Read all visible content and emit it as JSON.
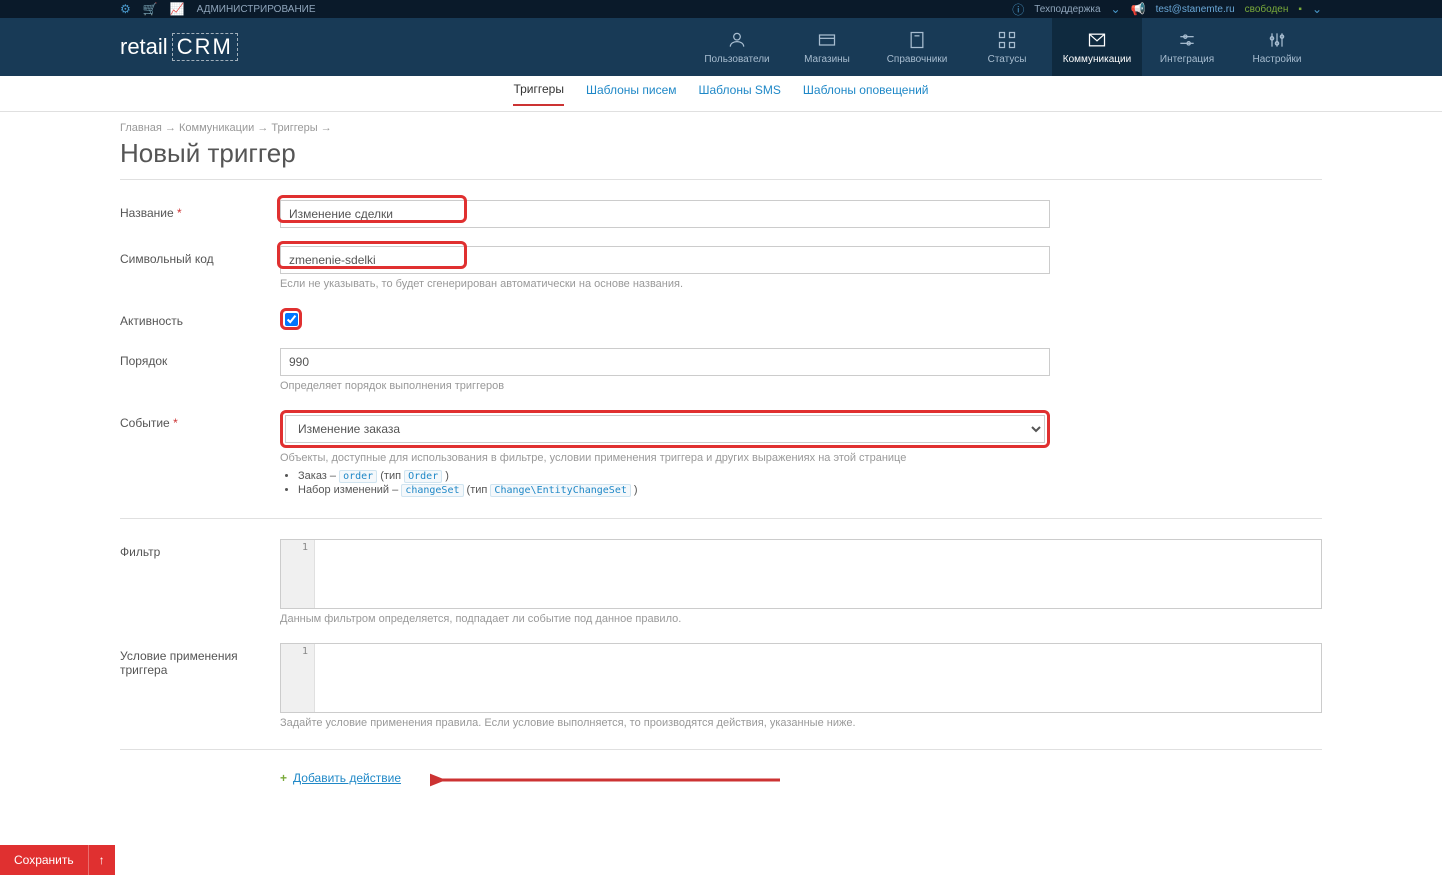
{
  "topbar": {
    "admin": "АДМИНИСТРИРОВАНИЕ",
    "support": "Техподдержка",
    "user_email": "test@stanemte.ru",
    "status": "свободен"
  },
  "logo": {
    "brand1": "retail",
    "brand2": "CRM"
  },
  "nav": {
    "users": "Пользователи",
    "stores": "Магазины",
    "dicts": "Справочники",
    "statuses": "Статусы",
    "comm": "Коммуникации",
    "integr": "Интеграция",
    "settings": "Настройки"
  },
  "subnav": {
    "triggers": "Триггеры",
    "letter_tpl": "Шаблоны писем",
    "sms_tpl": "Шаблоны SMS",
    "notify_tpl": "Шаблоны оповещений"
  },
  "breadcrumb": {
    "home": "Главная",
    "comm": "Коммуникации",
    "triggers": "Триггеры",
    "sep": "→"
  },
  "page_title": "Новый триггер",
  "form": {
    "name_label": "Название",
    "name_value": "Изменение сделки",
    "code_label": "Символьный код",
    "code_value": "zmenenie-sdelki",
    "code_hint": "Если не указывать, то будет сгенерирован автоматически на основе названия.",
    "active_label": "Активность",
    "order_label": "Порядок",
    "order_value": "990",
    "order_hint": "Определяет порядок выполнения триггеров",
    "event_label": "Событие",
    "event_value": "Изменение заказа",
    "event_hint": "Объекты, доступные для использования в фильтре, условии применения триггера и других выражениях на этой странице",
    "obj1_pre": "Заказ – ",
    "obj1_code1": "order",
    "obj1_mid": " (тип ",
    "obj1_code2": "Order",
    "obj1_post": " )",
    "obj2_pre": "Набор изменений – ",
    "obj2_code1": "changeSet",
    "obj2_mid": " (тип ",
    "obj2_code2": "Change\\EntityChangeSet",
    "obj2_post": " )",
    "filter_label": "Фильтр",
    "filter_hint": "Данным фильтром определяется, подпадает ли событие под данное правило.",
    "cond_label": "Условие применения триггера",
    "cond_hint": "Задайте условие применения правила. Если условие выполняется, то производятся действия, указанные ниже.",
    "line_no": "1",
    "add_action": "Добавить действие"
  },
  "save_button": "Сохранить"
}
